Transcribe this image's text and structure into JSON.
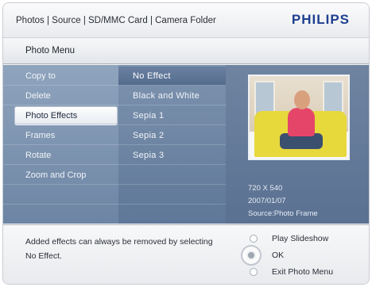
{
  "header": {
    "breadcrumb": "Photos | Source | SD/MMC Card | Camera Folder",
    "brand": "PHILIPS"
  },
  "menu_title": "Photo Menu",
  "menu_items": [
    {
      "label": "Copy to",
      "selected": false
    },
    {
      "label": "Delete",
      "selected": false
    },
    {
      "label": "Photo Effects",
      "selected": true
    },
    {
      "label": "Frames",
      "selected": false
    },
    {
      "label": "Rotate",
      "selected": false
    },
    {
      "label": "Zoom and Crop",
      "selected": false
    }
  ],
  "effects": [
    {
      "label": "No Effect",
      "selected": true
    },
    {
      "label": "Black and White",
      "selected": false
    },
    {
      "label": "Sepia 1",
      "selected": false
    },
    {
      "label": "Sepia 2",
      "selected": false
    },
    {
      "label": "Sepia 3",
      "selected": false
    }
  ],
  "photo_info": {
    "resolution": "720 X 540",
    "date": "2007/01/07",
    "source": "Source:Photo Frame"
  },
  "help_text": "Added effects can always be removed by selecting No Effect.",
  "actions": {
    "play_slideshow": "Play Slideshow",
    "ok": "OK",
    "exit": "Exit Photo Menu"
  }
}
